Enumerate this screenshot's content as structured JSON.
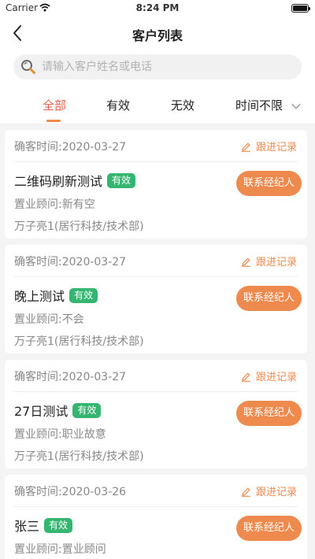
{
  "status_bar": {
    "carrier": "Carrier",
    "time": "8:24 PM"
  },
  "nav": {
    "title": "客户列表",
    "back_icon": "chevron-left-icon"
  },
  "search": {
    "placeholder": "请输入客户姓名或电话",
    "value": "",
    "icon": "search-icon"
  },
  "tabs": [
    {
      "label": "全部",
      "active": true
    },
    {
      "label": "有效",
      "active": false
    },
    {
      "label": "无效",
      "active": false
    },
    {
      "label": "时间不限",
      "active": false
    }
  ],
  "colors": {
    "accent": "#ee8a4d",
    "active_tab": "#e8604b",
    "badge": "#34b570",
    "muted_text": "#888888"
  },
  "customers": [
    {
      "date": "确客时间:2020-03-27",
      "follow_label": "跟进记录",
      "name": "二维码刷新测试",
      "status": "有效",
      "consultant": "置业顾问:新有空",
      "company": "万子亮1(居行科技/技术部)",
      "contact_label": "联系经纪人"
    },
    {
      "date": "确客时间:2020-03-27",
      "follow_label": "跟进记录",
      "name": "晚上测试",
      "status": "有效",
      "consultant": "置业顾问:不会",
      "company": "万子亮1(居行科技/技术部)",
      "contact_label": "联系经纪人"
    },
    {
      "date": "确客时间:2020-03-27",
      "follow_label": "跟进记录",
      "name": "27日测试",
      "status": "有效",
      "consultant": "置业顾问:职业故意",
      "company": "万子亮1(居行科技/技术部)",
      "contact_label": "联系经纪人"
    },
    {
      "date": "确客时间:2020-03-26",
      "follow_label": "跟进记录",
      "name": "张三",
      "status": "有效",
      "consultant": "置业顾问:置业顾问",
      "company": "",
      "contact_label": "联系经纪人"
    }
  ]
}
